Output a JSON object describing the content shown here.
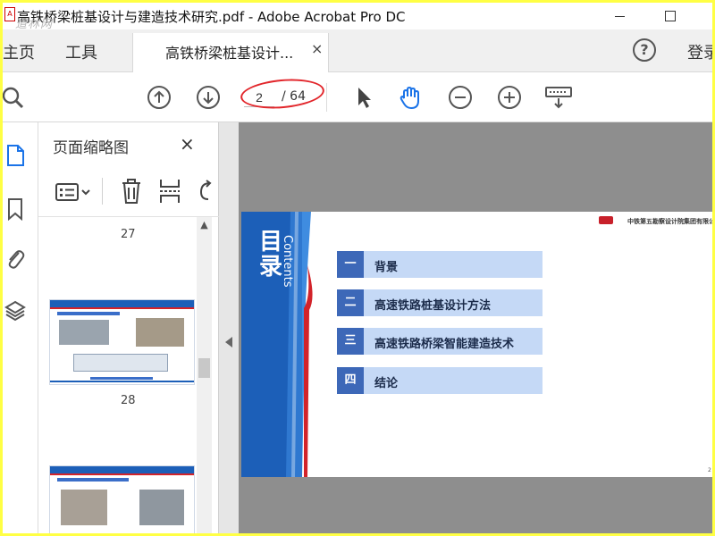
{
  "window": {
    "title": "高铁桥梁桩基设计与建造技术研究.pdf - Adobe Acrobat Pro DC",
    "watermark": "道林网",
    "icon_glyph": "A"
  },
  "tabs": {
    "home": "主页",
    "tools": "工具",
    "document_tab": "高铁桥梁桩基设计...",
    "document_tab_close": "×",
    "help": "?",
    "login": "登录"
  },
  "toolbar": {
    "current_page": "2",
    "total_pages": "/ 64",
    "icons": [
      "search-icon",
      "page-up-icon",
      "page-down-icon",
      "select-arrow-icon",
      "hand-tool-icon",
      "zoom-out-icon",
      "zoom-in-icon",
      "keyboard-icon"
    ]
  },
  "left_rail": {
    "icons": [
      "page-thumbnails-icon",
      "bookmark-icon",
      "attachment-icon",
      "layers-icon"
    ]
  },
  "thumbnail_panel": {
    "title": "页面缩略图",
    "close": "×",
    "page_numbers": [
      "27",
      "28"
    ]
  },
  "slide": {
    "title_cn": "目录",
    "title_en": "Contents",
    "company_name": "中铁第五勘察设计院集团有限公司",
    "page_number": "2",
    "toc": [
      {
        "num": "一",
        "text": "背景"
      },
      {
        "num": "二",
        "text": "高速铁路桩基设计方法"
      },
      {
        "num": "三",
        "text": "高速铁路桥梁智能建造技术"
      },
      {
        "num": "四",
        "text": "结论"
      }
    ]
  },
  "colors": {
    "accent_blue": "#1a73e8",
    "annotation_red": "#e2262b",
    "slide_blue": "#1c5fb8",
    "toc_fill": "#c5d9f6",
    "toc_num": "#3d68b8",
    "border_yellow": "#ffff44"
  }
}
